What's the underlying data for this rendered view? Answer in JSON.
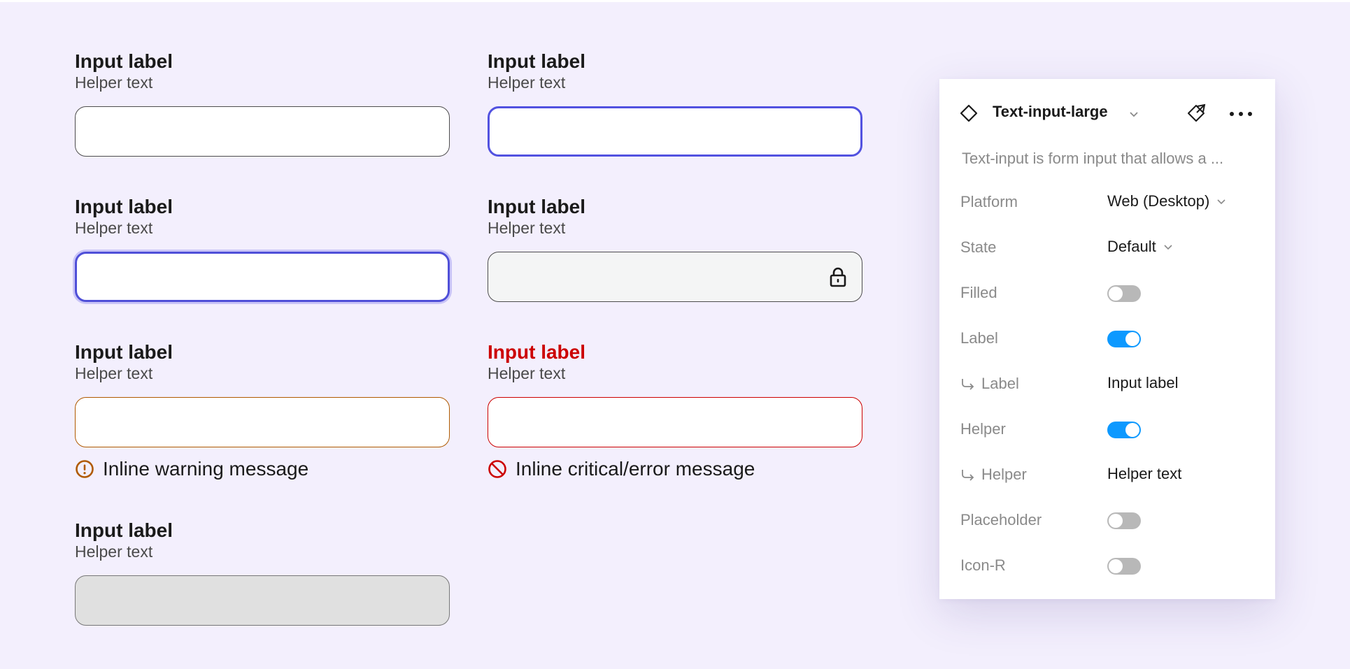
{
  "fields": [
    {
      "label": "Input label",
      "helper": "Helper text",
      "state": "default"
    },
    {
      "label": "Input label",
      "helper": "Helper text",
      "state": "hover"
    },
    {
      "label": "Input label",
      "helper": "Helper text",
      "state": "focus"
    },
    {
      "label": "Input label",
      "helper": "Helper text",
      "state": "readonly"
    },
    {
      "label": "Input label",
      "helper": "Helper text",
      "state": "warning",
      "message": "Inline warning message"
    },
    {
      "label": "Input label",
      "helper": "Helper text",
      "state": "error",
      "message": "Inline critical/error message"
    },
    {
      "label": "Input label",
      "helper": "Helper text",
      "state": "disabled"
    }
  ],
  "panel": {
    "component_name": "Text-input-large",
    "description": "Text-input is form input that allows a ...",
    "properties": [
      {
        "name": "Platform",
        "value": "Web (Desktop)",
        "type": "dropdown"
      },
      {
        "name": "State",
        "value": "Default",
        "type": "dropdown"
      },
      {
        "name": "Filled",
        "value": "off",
        "type": "toggle"
      },
      {
        "name": "Label",
        "value": "on",
        "type": "toggle"
      },
      {
        "name": "Label",
        "value": "Input label",
        "type": "text",
        "nested": true
      },
      {
        "name": "Helper",
        "value": "on",
        "type": "toggle"
      },
      {
        "name": "Helper",
        "value": "Helper text",
        "type": "text",
        "nested": true
      },
      {
        "name": "Placeholder",
        "value": "off",
        "type": "toggle"
      },
      {
        "name": "Icon-R",
        "value": "off",
        "type": "toggle"
      }
    ]
  },
  "colors": {
    "canvas_bg": "#f3effd",
    "hover_border": "#5252e0",
    "warning": "#b05a00",
    "error": "#cc0000",
    "toggle_on": "#0d99ff"
  },
  "icons": {
    "readonly": "lock-icon",
    "warning": "warning-icon",
    "error": "error-icon",
    "panel_component": "component-diamond-icon",
    "panel_detach": "detach-instance-icon",
    "panel_more": "more-icon"
  }
}
